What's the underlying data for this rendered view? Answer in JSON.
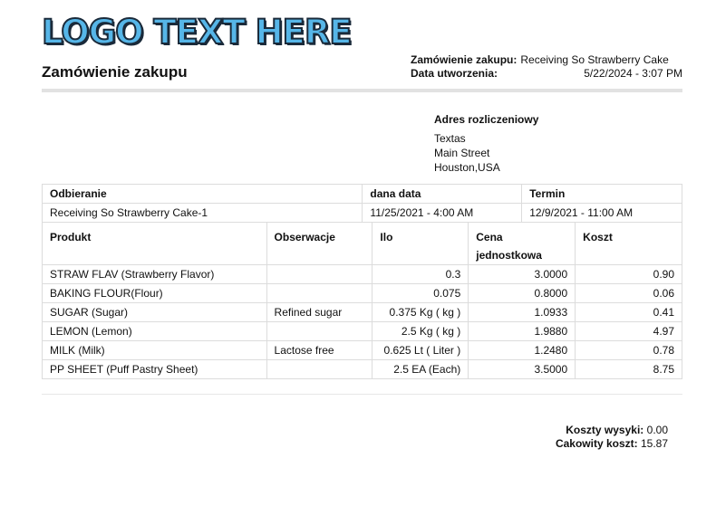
{
  "logo": {
    "text": "LOGO TEXT HERE"
  },
  "title": "Zamówienie zakupu",
  "meta": {
    "order_label": "Zamówienie zakupu:",
    "order_value": "Receiving So Strawberry Cake",
    "created_label": "Data utworzenia:",
    "created_value": "5/22/2024 - 3:07 PM"
  },
  "billing": {
    "heading": "Adres rozliczeniowy",
    "lines": [
      "Textas",
      "Main Street",
      "Houston,USA"
    ]
  },
  "receiving": {
    "headers": [
      "Odbieranie",
      "dana data",
      "Termin"
    ],
    "row": [
      "Receiving So Strawberry Cake-1",
      "11/25/2021 - 4:00 AM",
      "12/9/2021 - 11:00 AM"
    ]
  },
  "items": {
    "headers": [
      "Produkt",
      "Obserwacje",
      "Ilo",
      "Cena jednostkowa",
      "Koszt"
    ],
    "rows": [
      [
        "STRAW FLAV (Strawberry Flavor)",
        "",
        "0.3",
        "3.0000",
        "0.90"
      ],
      [
        "BAKING FLOUR(Flour)",
        "",
        "0.075",
        "0.8000",
        "0.06"
      ],
      [
        "SUGAR (Sugar)",
        "Refined sugar",
        "0.375 Kg ( kg )",
        "1.0933",
        "0.41"
      ],
      [
        "LEMON (Lemon)",
        "",
        "2.5 Kg ( kg )",
        "1.9880",
        "4.97"
      ],
      [
        "MILK (Milk)",
        "Lactose free",
        "0.625 Lt ( Liter )",
        "1.2480",
        "0.78"
      ],
      [
        "PP SHEET (Puff Pastry Sheet)",
        "",
        "2.5 EA (Each)",
        "3.5000",
        "8.75"
      ]
    ]
  },
  "totals": {
    "shipping_label": "Koszty wysyki:",
    "shipping_value": "0.00",
    "total_label": "Cakowity koszt:",
    "total_value": "15.87"
  }
}
